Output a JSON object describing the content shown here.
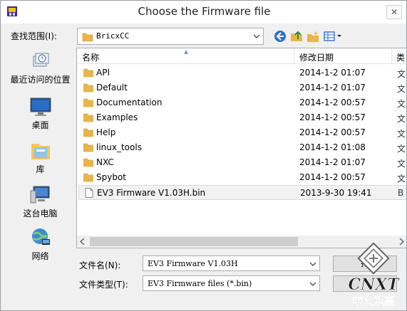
{
  "window": {
    "title": "Choose the Firmware file",
    "close_label": "✕"
  },
  "lookin": {
    "label": "查找范围(I):",
    "value": "BricxCC"
  },
  "toolbar": {
    "icons": [
      "back-icon",
      "up-folder-icon",
      "new-folder-icon",
      "view-menu-icon"
    ]
  },
  "places": [
    {
      "label": "最近访问的位置",
      "icon": "recent-places-icon"
    },
    {
      "label": "桌面",
      "icon": "desktop-icon"
    },
    {
      "label": "库",
      "icon": "libraries-icon"
    },
    {
      "label": "这台电脑",
      "icon": "this-pc-icon"
    },
    {
      "label": "网络",
      "icon": "network-icon"
    }
  ],
  "filelist": {
    "columns": {
      "name": "名称",
      "date": "修改日期",
      "type": "类"
    },
    "rows": [
      {
        "name": "API",
        "date": "2014-1-2 01:07",
        "type": "文",
        "kind": "folder"
      },
      {
        "name": "Default",
        "date": "2014-1-2 01:07",
        "type": "文",
        "kind": "folder"
      },
      {
        "name": "Documentation",
        "date": "2014-1-2 00:57",
        "type": "文",
        "kind": "folder"
      },
      {
        "name": "Examples",
        "date": "2014-1-2 00:57",
        "type": "文",
        "kind": "folder"
      },
      {
        "name": "Help",
        "date": "2014-1-2 00:57",
        "type": "文",
        "kind": "folder"
      },
      {
        "name": "linux_tools",
        "date": "2014-1-2 01:08",
        "type": "文",
        "kind": "folder"
      },
      {
        "name": "NXC",
        "date": "2014-1-2 01:07",
        "type": "文",
        "kind": "folder"
      },
      {
        "name": "Spybot",
        "date": "2014-1-2 00:57",
        "type": "文",
        "kind": "folder"
      },
      {
        "name": "EV3 Firmware V1.03H.bin",
        "date": "2013-9-30 19:41",
        "type": "B",
        "kind": "file",
        "selected": true
      }
    ]
  },
  "filename": {
    "label": "文件名(N):",
    "value": "EV3 Firmware V1.03H"
  },
  "filetype": {
    "label": "文件类型(T):",
    "value": "EV3 Firmware files (*.bin)"
  },
  "buttons": {
    "open": "打",
    "cancel": ""
  },
  "watermark": {
    "brand": "CNXT",
    "caption": "中文乐高"
  },
  "colors": {
    "folder": "#e8b64a",
    "accent": "#2f6fc4"
  }
}
